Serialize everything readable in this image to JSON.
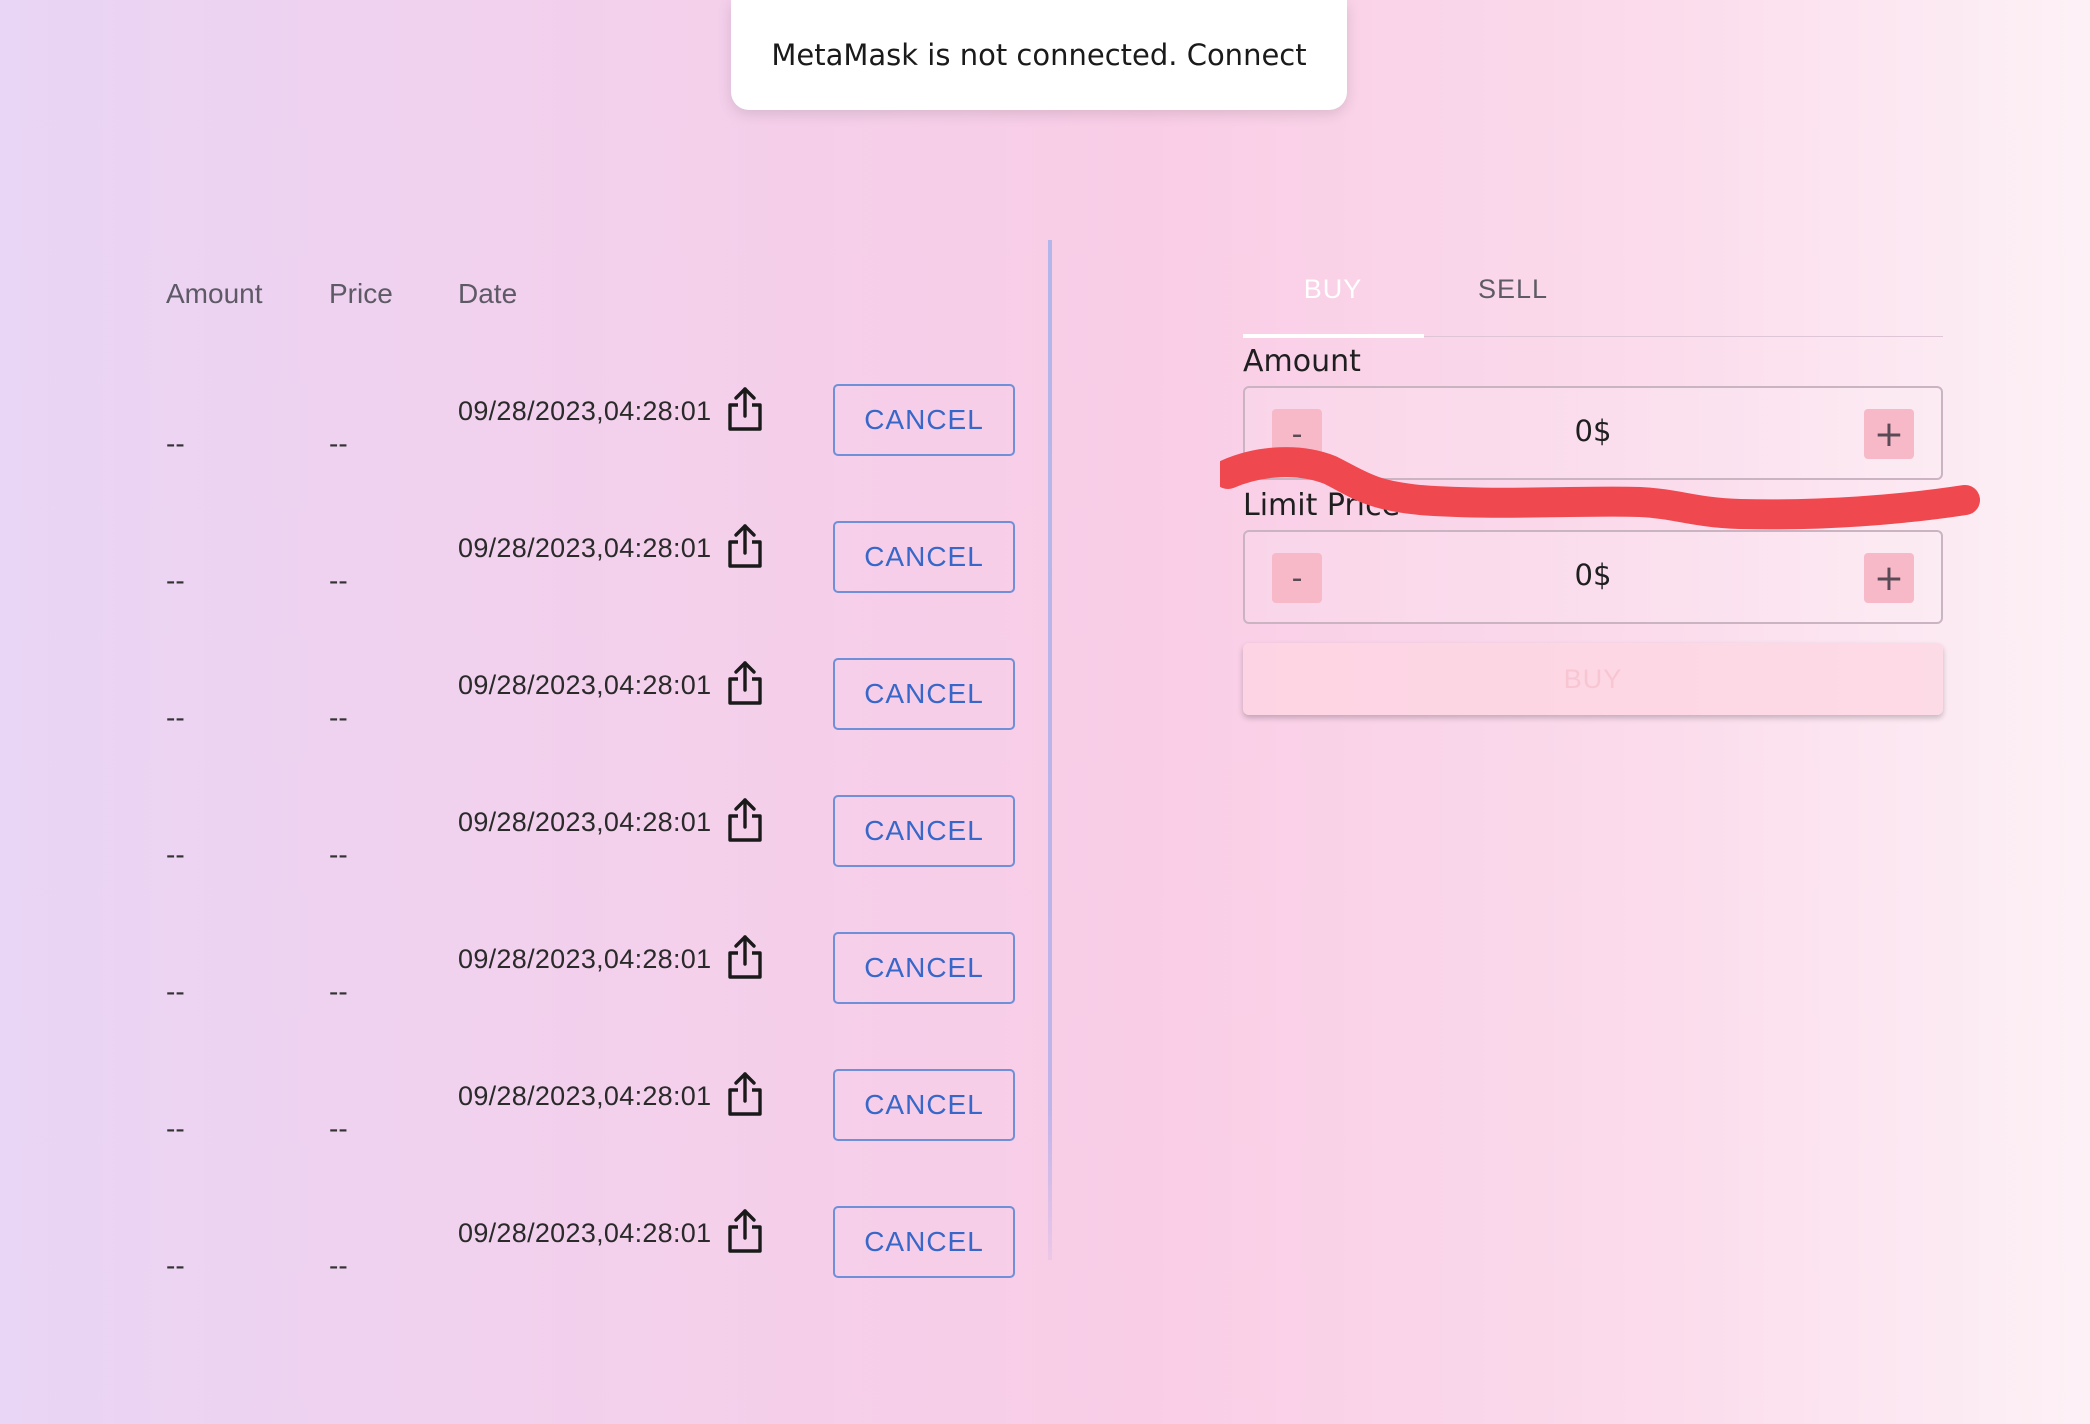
{
  "toast": {
    "message": "MetaMask is not connected. Connect"
  },
  "orders": {
    "headers": {
      "amount": "Amount",
      "price": "Price",
      "date": "Date"
    },
    "rows": [
      {
        "amount": "--",
        "price": "--",
        "date": "09/28/2023,04:28:01",
        "action": "CANCEL"
      },
      {
        "amount": "--",
        "price": "--",
        "date": "09/28/2023,04:28:01",
        "action": "CANCEL"
      },
      {
        "amount": "--",
        "price": "--",
        "date": "09/28/2023,04:28:01",
        "action": "CANCEL"
      },
      {
        "amount": "--",
        "price": "--",
        "date": "09/28/2023,04:28:01",
        "action": "CANCEL"
      },
      {
        "amount": "--",
        "price": "--",
        "date": "09/28/2023,04:28:01",
        "action": "CANCEL"
      },
      {
        "amount": "--",
        "price": "--",
        "date": "09/28/2023,04:28:01",
        "action": "CANCEL"
      },
      {
        "amount": "--",
        "price": "--",
        "date": "09/28/2023,04:28:01",
        "action": "CANCEL"
      }
    ],
    "row_icon": "share-icon"
  },
  "trade": {
    "tabs": [
      {
        "label": "BUY",
        "active": true
      },
      {
        "label": "SELL",
        "active": false
      }
    ],
    "amount": {
      "label": "Amount",
      "value": "0$",
      "minus": "-",
      "plus": "+"
    },
    "limit_price": {
      "label": "Limit Price",
      "value": "0$",
      "minus": "-",
      "plus": "+"
    },
    "submit_label": "BUY"
  },
  "colors": {
    "accent_blue": "#3767c8",
    "stepper_pink": "#f7b9c8",
    "annotation_red": "#f0484f"
  }
}
